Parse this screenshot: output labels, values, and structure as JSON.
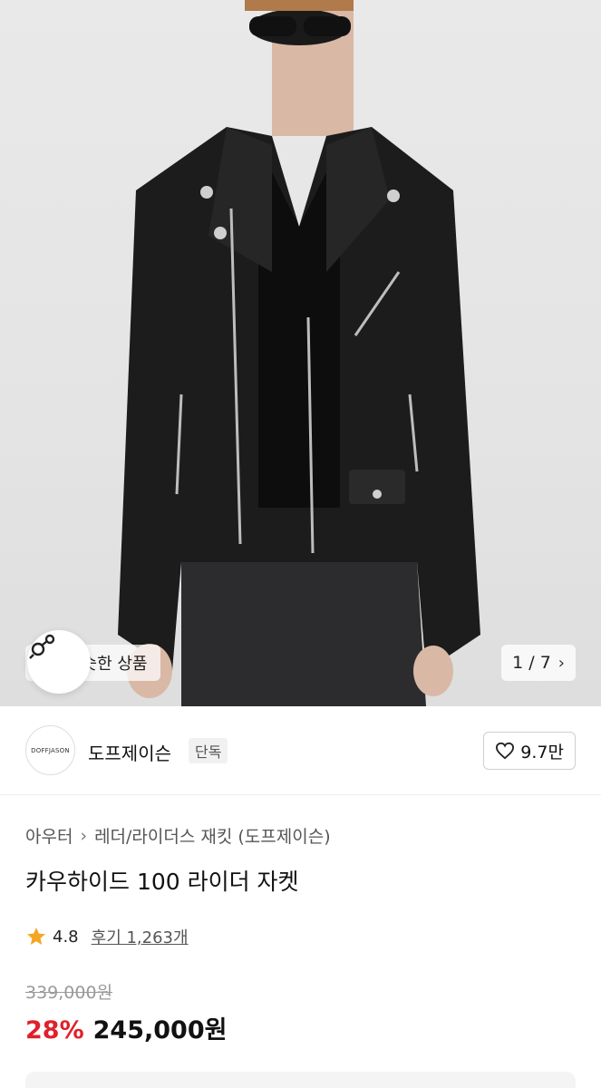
{
  "gallery": {
    "similar_label": "비슷한 상품",
    "counter": "1 / 7"
  },
  "brand": {
    "logo_text": "DOFFJASON",
    "name": "도프제이슨",
    "tag": "단독",
    "likes": "9.7만"
  },
  "product": {
    "breadcrumb": [
      "아우터",
      "레더/라이더스 재킷 (도프제이슨)"
    ],
    "title": "카우하이드 100 라이더 자켓",
    "rating": "4.8",
    "reviews": "후기 1,263개",
    "original_price": "339,000원",
    "discount": "28%",
    "price": "245,000원"
  },
  "colors": {
    "accent_red": "#e0202a",
    "star": "#f5a623"
  },
  "icons": [
    "similar-search-icon",
    "chevron-right-icon",
    "heart-icon",
    "star-icon"
  ]
}
